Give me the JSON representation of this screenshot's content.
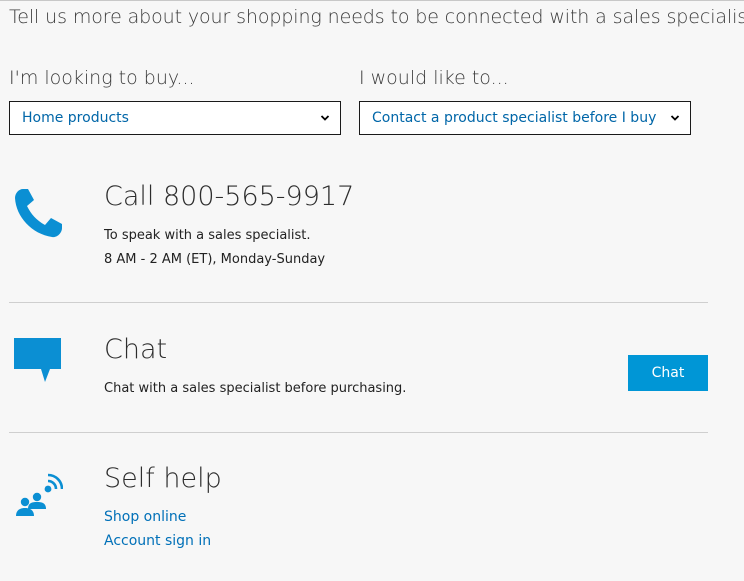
{
  "intro": "Tell us more about your shopping needs to be connected with a sales specialist.",
  "filters": {
    "buy_label": "I'm looking to buy...",
    "buy_value": "Home products",
    "action_label": "I would like to...",
    "action_value": "Contact a product specialist before I buy"
  },
  "call": {
    "heading": "Call 800-565-9917",
    "line1": "To speak with a sales specialist.",
    "line2": "8 AM - 2 AM (ET), Monday-Sunday"
  },
  "chat": {
    "heading": "Chat",
    "description": "Chat with a sales specialist before purchasing.",
    "button_label": "Chat"
  },
  "self_help": {
    "heading": "Self help",
    "links": [
      "Shop online",
      "Account sign in"
    ]
  },
  "colors": {
    "accent": "#0096d6",
    "link": "#0070b8",
    "icon": "#0b8fd3"
  },
  "icons": {
    "call": "phone-icon",
    "chat": "chat-bubble-icon",
    "self_help": "self-help-icon",
    "dropdown": "chevron-down-icon"
  }
}
